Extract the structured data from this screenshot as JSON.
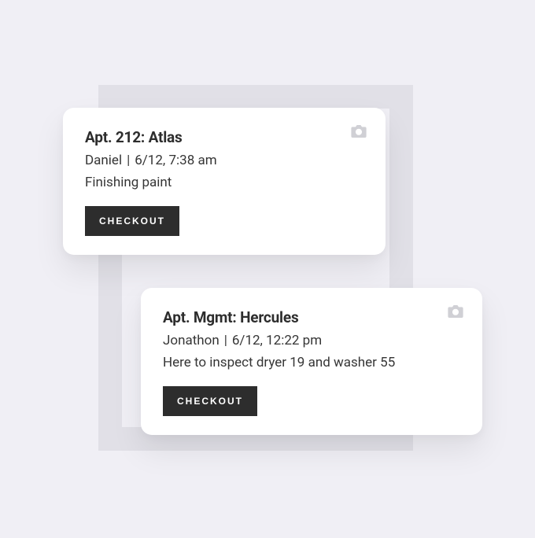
{
  "cards": [
    {
      "title": "Apt. 212: Atlas",
      "person": "Daniel",
      "timestamp": "6/12, 7:38 am",
      "note": "Finishing paint",
      "button_label": "CHECKOUT"
    },
    {
      "title": "Apt. Mgmt: Hercules",
      "person": "Jonathon",
      "timestamp": "6/12, 12:22 pm",
      "note": "Here to inspect dryer 19 and washer 55",
      "button_label": "CHECKOUT"
    }
  ]
}
